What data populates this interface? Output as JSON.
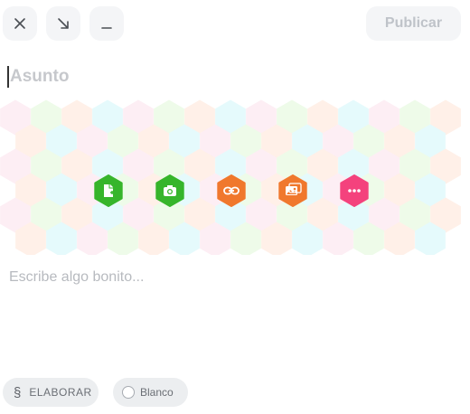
{
  "toolbar": {
    "close_icon": "close-icon",
    "minimize_icon": "arrow-down-right-icon",
    "collapse_icon": "minus-icon",
    "publish_label": "Publicar"
  },
  "editor": {
    "subject_placeholder": "Asunto",
    "body_placeholder": "Escribe algo bonito..."
  },
  "attachments": [
    {
      "icon": "file-add-icon",
      "color": "#36b52b"
    },
    {
      "icon": "camera-icon",
      "color": "#36b52b"
    },
    {
      "icon": "link-icon",
      "color": "#f0782d"
    },
    {
      "icon": "image-icon",
      "color": "#f0782d"
    },
    {
      "icon": "more-icon",
      "color": "#f4427d"
    }
  ],
  "pattern_colors": [
    "#fdeef4",
    "#eefbe9",
    "#fff0e8",
    "#e5fafc"
  ],
  "footer": {
    "elaborar_label": "ELABORAR",
    "elaborar_icon": "section-icon",
    "blanco_label": "Blanco",
    "blanco_icon": "radio-icon"
  }
}
